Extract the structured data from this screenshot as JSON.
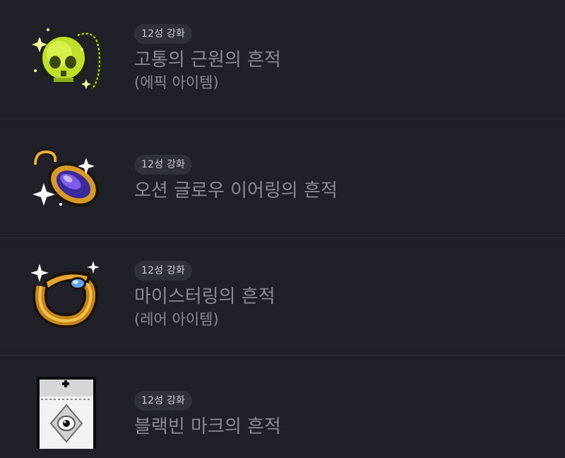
{
  "items": [
    {
      "badge": "12성 강화",
      "name": "고통의 근원의 흔적",
      "sub": "(에픽 아이템)",
      "icon": "skull-pendant-icon"
    },
    {
      "badge": "12성 강화",
      "name": "오션 글로우 이어링의 흔적",
      "sub": "",
      "icon": "ocean-glow-earring-icon"
    },
    {
      "badge": "12성 강화",
      "name": "마이스터링의 흔적",
      "sub": "(레어 아이템)",
      "icon": "meister-ring-icon"
    },
    {
      "badge": "12성 강화",
      "name": "블랙빈 마크의 흔적",
      "sub": "",
      "icon": "black-bean-mark-icon"
    }
  ],
  "colors": {
    "background": "#1f2028",
    "divider": "#32343d",
    "badge_bg": "#30323b",
    "text_muted": "#8a8b90"
  }
}
